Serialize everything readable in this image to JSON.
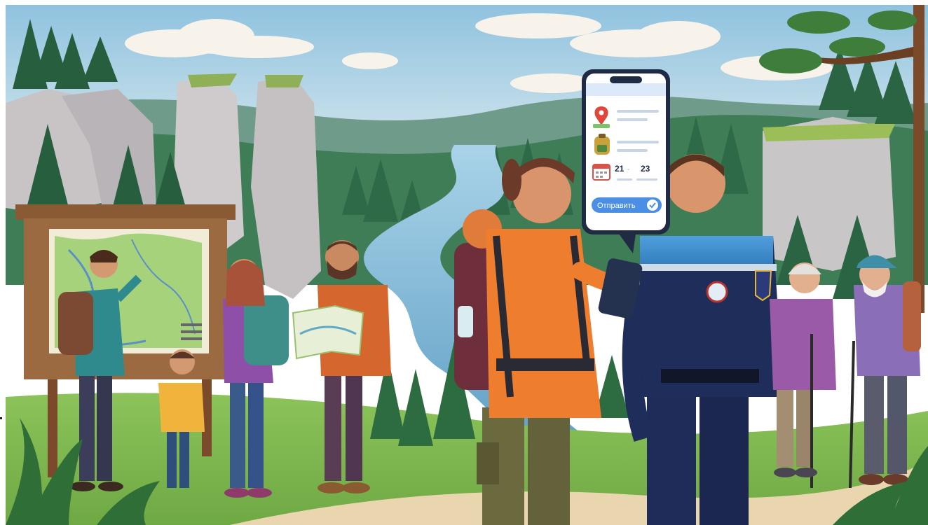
{
  "phone": {
    "date_from": "21",
    "date_separator": "-",
    "date_to": "23",
    "submit_label": "Отправить"
  },
  "colors": {
    "sky": "#a9cfe3",
    "forest": "#2f6e48",
    "river": "#7fb6d3",
    "rock": "#c9c6c7",
    "ground": "#9ccc5e",
    "path": "#e8d5b0",
    "jacket_orange": "#ea7a2b",
    "uniform_navy": "#1f2d5a",
    "uniform_blue": "#3f8fd0",
    "accent_button": "#4a8ee6"
  },
  "icons": [
    "map-pin-icon",
    "backpack-icon",
    "calendar-icon",
    "checkmark-icon"
  ]
}
